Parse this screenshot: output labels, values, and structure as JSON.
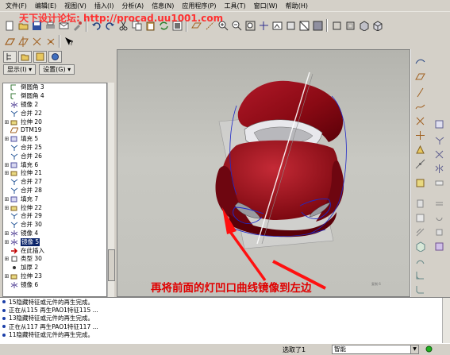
{
  "menubar": {
    "items": [
      "文件(F)",
      "编辑(E)",
      "视图(V)",
      "插入(I)",
      "分析(A)",
      "信息(N)",
      "应用程序(P)",
      "工具(T)",
      "窗口(W)",
      "帮助(H)"
    ]
  },
  "watermark": {
    "text": "天下设计论坛: http://procad.uu1001.com"
  },
  "left_panel": {
    "show_menu": "显示(I) ▾",
    "settings_menu": "设置(G) ▾"
  },
  "model_tree": {
    "items": [
      {
        "label": "倒圆角 3",
        "expandable": false,
        "icon": "round-icon"
      },
      {
        "label": "倒圆角 4",
        "expandable": false,
        "icon": "round-icon"
      },
      {
        "label": "镜像 2",
        "expandable": false,
        "icon": "mirror-icon"
      },
      {
        "label": "合并 22",
        "expandable": false,
        "icon": "merge-icon"
      },
      {
        "label": "拉伸 20",
        "expandable": true,
        "icon": "extrude-icon"
      },
      {
        "label": "DTM19",
        "expandable": false,
        "icon": "datum-plane-icon"
      },
      {
        "label": "填充 5",
        "expandable": true,
        "icon": "fill-icon"
      },
      {
        "label": "合并 25",
        "expandable": false,
        "icon": "merge-icon"
      },
      {
        "label": "合并 26",
        "expandable": false,
        "icon": "merge-icon"
      },
      {
        "label": "填充 6",
        "expandable": true,
        "icon": "fill-icon"
      },
      {
        "label": "拉伸 21",
        "expandable": true,
        "icon": "extrude-icon"
      },
      {
        "label": "合并 27",
        "expandable": false,
        "icon": "merge-icon"
      },
      {
        "label": "合并 28",
        "expandable": false,
        "icon": "merge-icon"
      },
      {
        "label": "填充 7",
        "expandable": true,
        "icon": "fill-icon"
      },
      {
        "label": "拉伸 22",
        "expandable": true,
        "icon": "extrude-icon"
      },
      {
        "label": "合并 29",
        "expandable": false,
        "icon": "merge-icon"
      },
      {
        "label": "合并 30",
        "expandable": false,
        "icon": "merge-icon"
      },
      {
        "label": "镜像 4",
        "expandable": true,
        "icon": "mirror-icon"
      },
      {
        "label": "镜像 5",
        "expandable": true,
        "icon": "mirror-icon",
        "selected": true
      },
      {
        "label": "在此插入",
        "expandable": false,
        "icon": "insert-here-icon"
      },
      {
        "label": "类型 30",
        "expandable": true,
        "icon": "type-icon"
      },
      {
        "label": "加厚 2",
        "expandable": false,
        "icon": "thicken-icon"
      },
      {
        "label": "拉伸 23",
        "expandable": true,
        "icon": "extrude-icon"
      },
      {
        "label": "镜像 6",
        "expandable": false,
        "icon": "mirror-icon"
      }
    ]
  },
  "viewport": {
    "caption": "再将前面的灯凹口曲线镜像到左边",
    "corner_note": "复制 6"
  },
  "messages": {
    "lines": [
      "15隐藏特征或元件的再生完成。",
      "正在从115 再生PAO1特征115 ...",
      "13隐藏特征或元件的再生完成。",
      "正在从117 再生PAO1特征117 ...",
      "11隐藏特征或元件的再生完成。"
    ]
  },
  "statusbar": {
    "selected_count": "选取了1",
    "filter": "智能"
  },
  "colors": {
    "window_bg": "#d4d0c8",
    "selection": "#0a246a",
    "car_body": "#8a0a14",
    "caption_red": "#e00000",
    "curve_blue": "#1e28c8"
  }
}
